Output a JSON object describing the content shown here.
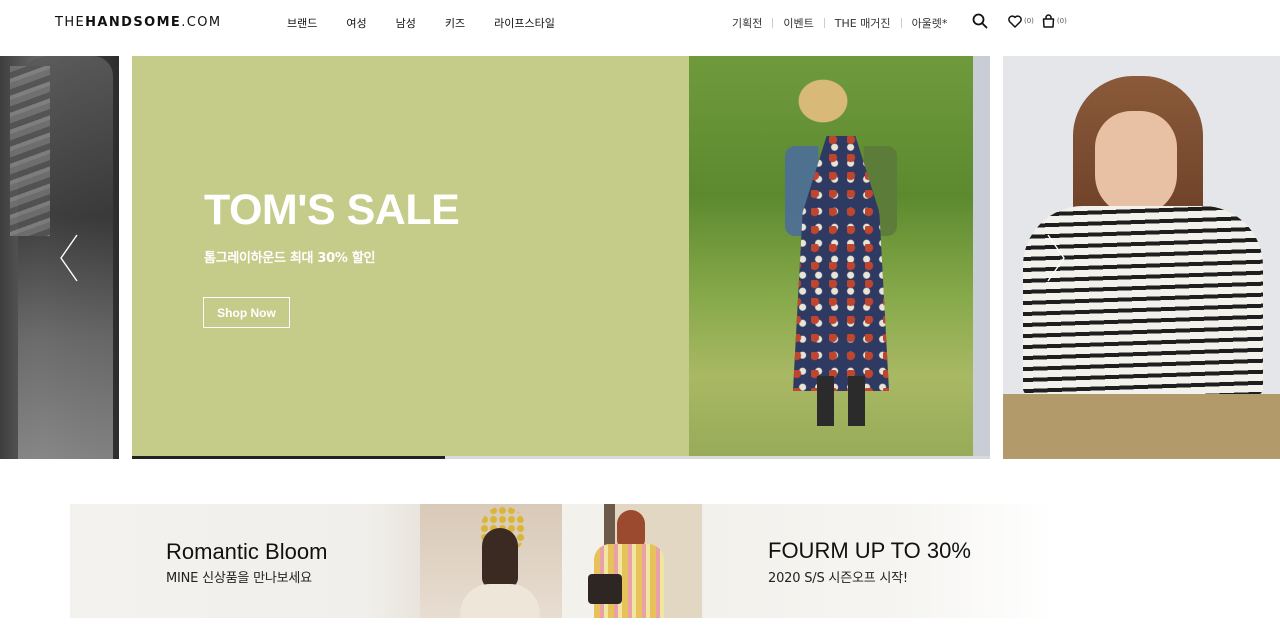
{
  "header": {
    "logo_light": "THE",
    "logo_bold": "HANDSOME",
    "logo_suffix": ".COM",
    "nav": [
      "브랜드",
      "여성",
      "남성",
      "키즈",
      "라이프스타일"
    ],
    "util": [
      "기획전",
      "이벤트",
      "THE 매거진",
      "아울렛*"
    ],
    "wishlist_count": "(0)",
    "cart_count": "(0)",
    "icons": {
      "search": "search-icon",
      "wishlist": "heart-icon",
      "cart": "shopping-bag-icon"
    }
  },
  "hero": {
    "title": "TOM'S SALE",
    "subtitle": "톰그레이하운드 최대 30% 할인",
    "cta": "Shop Now",
    "background_color": "#c5cb88",
    "progress": 0.365,
    "arrows": {
      "prev": "chevron-left-icon",
      "next": "chevron-right-icon"
    }
  },
  "promos": [
    {
      "title": "Romantic Bloom",
      "subtitle": "MINE 신상품을 만나보세요"
    },
    {
      "title": "FOURM UP TO 30%",
      "subtitle": "2020 S/S 시즌오프 시작!"
    }
  ]
}
